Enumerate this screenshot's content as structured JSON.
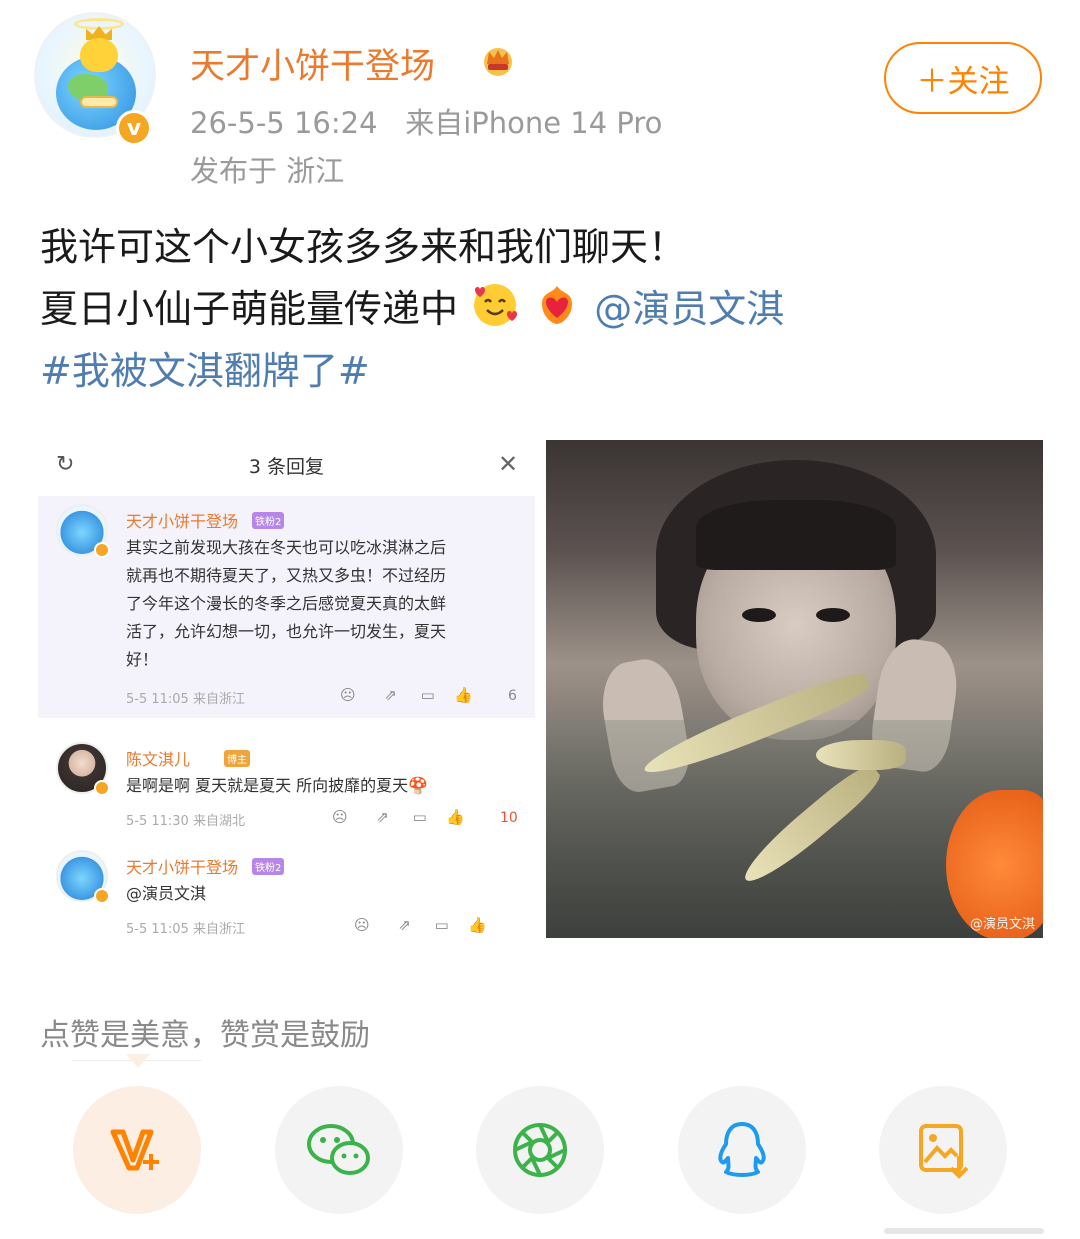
{
  "post": {
    "username": "天才小饼干登场",
    "timestamp": "26-5-5 16:24",
    "source": "来自iPhone 14 Pro",
    "location": "发布于 浙江",
    "follow_label": "＋关注",
    "text_line1": "我许可这个小女孩多多来和我们聊天！",
    "text_line2_prefix": "夏日小仙子萌能量传递中",
    "mention": "@演员文淇",
    "topic": "#我被文淇翻牌了#"
  },
  "screenshot": {
    "title": "3 条回复",
    "comments": [
      {
        "name": "天才小饼干登场",
        "badge": "铁粉2",
        "text_lines": [
          "其实之前发现大孩在冬天也可以吃冰淇淋之后",
          "就再也不期待夏天了，又热又多虫！不过经历",
          "了今年这个漫长的冬季之后感觉夏天真的太鲜",
          "活了，允许幻想一切，也允许一切发生，夏天",
          "好！"
        ],
        "time": "5-5 11:05",
        "from": "来自浙江",
        "likes": "6"
      },
      {
        "name": "陈文淇儿",
        "badge": "博主",
        "text_lines": [
          "是啊是啊 夏天就是夏天 所向披靡的夏天🍄"
        ],
        "time": "5-5 11:30",
        "from": "来自湖北",
        "likes": "10"
      },
      {
        "name": "天才小饼干登场",
        "badge": "铁粉2",
        "text_lines": [
          "@演员文淇"
        ],
        "time": "5-5 11:05",
        "from": "来自浙江",
        "likes": ""
      }
    ]
  },
  "photo": {
    "watermark": "@演员文淇"
  },
  "footer": {
    "appreciate_text": "点赞是美意，赞赏是鼓励"
  },
  "share_buttons": [
    {
      "name": "reward-icon",
      "color": "#ff8200"
    },
    {
      "name": "wechat-icon",
      "color": "#3bb34a"
    },
    {
      "name": "moments-icon",
      "color": "#3bb34a"
    },
    {
      "name": "qq-icon",
      "color": "#1d9bf0"
    },
    {
      "name": "save-image-icon",
      "color": "#f5a623"
    }
  ],
  "colors": {
    "username": "#eb7a2f",
    "link": "#507daf",
    "follow": "#ff8200"
  }
}
